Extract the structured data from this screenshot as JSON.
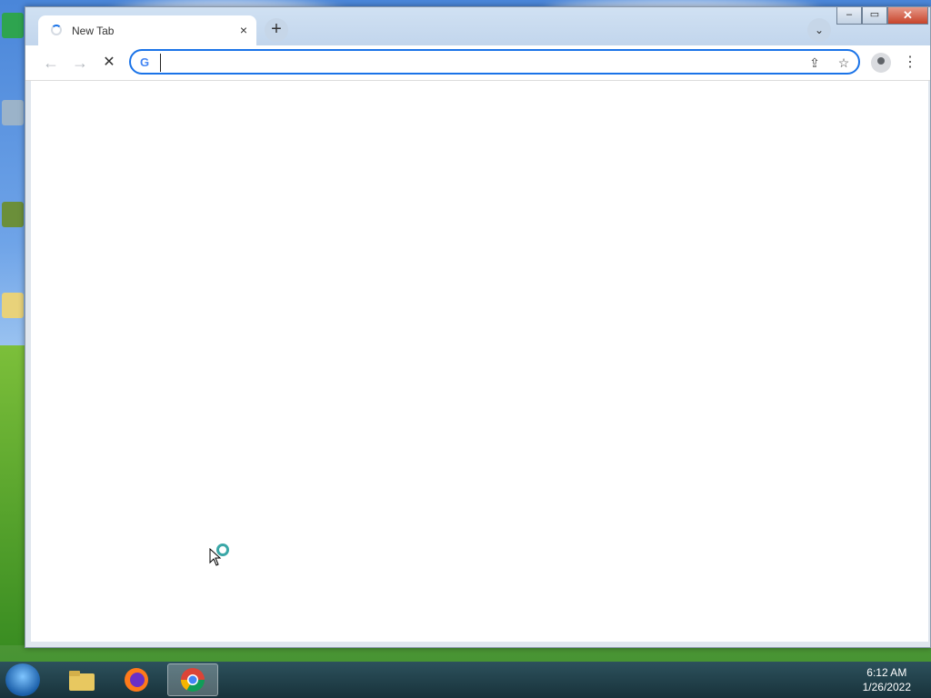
{
  "browser": {
    "tab": {
      "title": "New Tab",
      "close_icon": "×"
    },
    "new_tab_symbol": "+",
    "tab_search_symbol": "⌄",
    "caption": {
      "minimize": "–",
      "restore": "▭",
      "close": "✕"
    },
    "nav": {
      "back": "←",
      "forward": "→",
      "stop": "✕"
    },
    "omnibox": {
      "value": "",
      "placeholder": "",
      "g_label": "G"
    },
    "share_symbol": "⇪",
    "bookmark_symbol": "☆",
    "menu_symbol": "⋮"
  },
  "taskbar": {
    "apps": [
      "file-explorer",
      "firefox",
      "chrome"
    ],
    "clock": {
      "time": "6:12 AM",
      "date": "1/26/2022"
    }
  },
  "colors": {
    "accent": "#1a73e8",
    "taskbar": "#1e3a56"
  }
}
